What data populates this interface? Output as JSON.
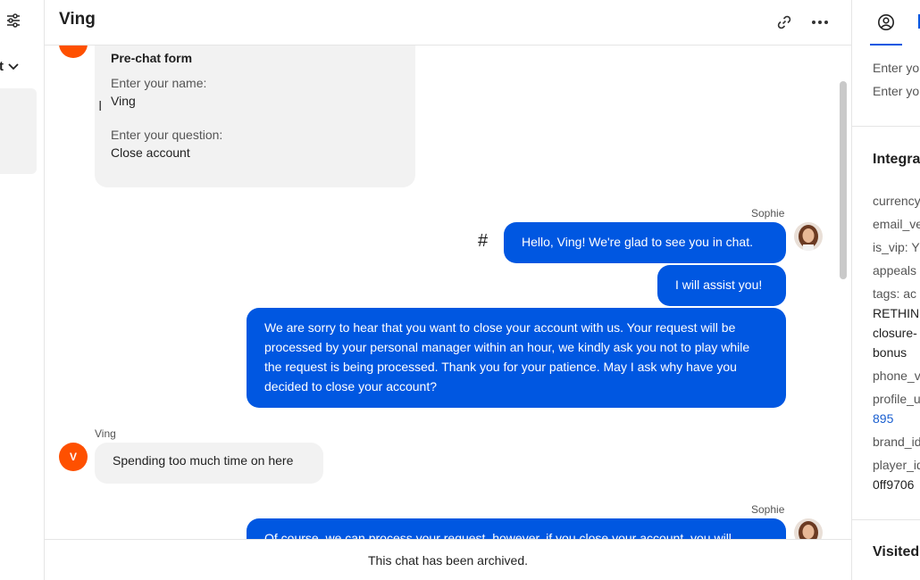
{
  "header": {
    "title": "Ving"
  },
  "left": {
    "dropdown_label": "t"
  },
  "prechat": {
    "title": "Pre-chat form",
    "name_label": "Enter your name:",
    "name_value": "Ving",
    "question_label": "Enter your question:",
    "question_value": "Close account"
  },
  "messages": {
    "sophie_name_1": "Sophie",
    "hash_symbol": "#",
    "msg1": "Hello, Ving! We're glad to see you in chat.",
    "msg2": "I will assist you!",
    "msg3": "We are sorry to hear that you want to close your account with us. Your request will be processed by your personal manager within an hour, we kindly ask you not to play while the request is being processed. Thank you for your patience. May I ask why have you decided to close your account?",
    "ving_name": "Ving",
    "ving_initial": "V",
    "msg4": "Spending too much time on here",
    "sophie_name_2": "Sophie",
    "msg5": "Of course, we can process your request, however, if you close your account, you will"
  },
  "footer": {
    "archived_text": "This chat has been archived."
  },
  "right_panel": {
    "field1": "Enter yo",
    "field2": "Enter yo",
    "integrations_heading": "Integra",
    "currency": "currency",
    "email_ver": "email_ve",
    "is_vip": "is_vip: Y",
    "appeals": "appeals",
    "tags": "tags: ac",
    "tags_line2": "RETHINI",
    "tags_line3": "closure-",
    "tags_line4": "bonus",
    "phone_ver": "phone_v",
    "profile_url": "profile_u",
    "profile_url_value": "895",
    "brand_id": "brand_id",
    "player_id": "player_id",
    "player_id_value": "0ff9706",
    "visited_heading": "Visited"
  },
  "colors": {
    "accent": "#0057e1",
    "avatar_orange": "#fe5000",
    "bubble_in": "#f2f2f2"
  }
}
